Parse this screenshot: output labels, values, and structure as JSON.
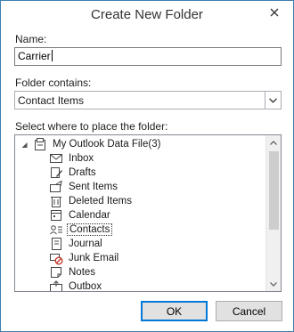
{
  "dialog": {
    "title": "Create New Folder",
    "close_icon": "close-icon"
  },
  "name_field": {
    "label": "Name:",
    "value": "Carrier"
  },
  "folder_contains": {
    "label": "Folder contains:",
    "selected": "Contact Items"
  },
  "tree": {
    "label": "Select where to place the folder:",
    "root": {
      "label": "My Outlook Data File(3)",
      "icon": "data-file-icon",
      "expanded": true
    },
    "items": [
      {
        "label": "Inbox",
        "icon": "inbox-icon"
      },
      {
        "label": "Drafts",
        "icon": "drafts-icon"
      },
      {
        "label": "Sent Items",
        "icon": "sent-items-icon"
      },
      {
        "label": "Deleted Items",
        "icon": "deleted-items-icon"
      },
      {
        "label": "Calendar",
        "icon": "calendar-icon"
      },
      {
        "label": "Contacts",
        "icon": "contacts-icon",
        "selected": true
      },
      {
        "label": "Journal",
        "icon": "journal-icon"
      },
      {
        "label": "Junk Email",
        "icon": "junk-email-icon"
      },
      {
        "label": "Notes",
        "icon": "notes-icon"
      },
      {
        "label": "Outbox",
        "icon": "outbox-icon"
      }
    ]
  },
  "buttons": {
    "ok": "OK",
    "cancel": "Cancel"
  },
  "colors": {
    "window_border": "#3c7fb1",
    "default_button_border": "#0078d7",
    "button_face": "#e1e1e1"
  }
}
